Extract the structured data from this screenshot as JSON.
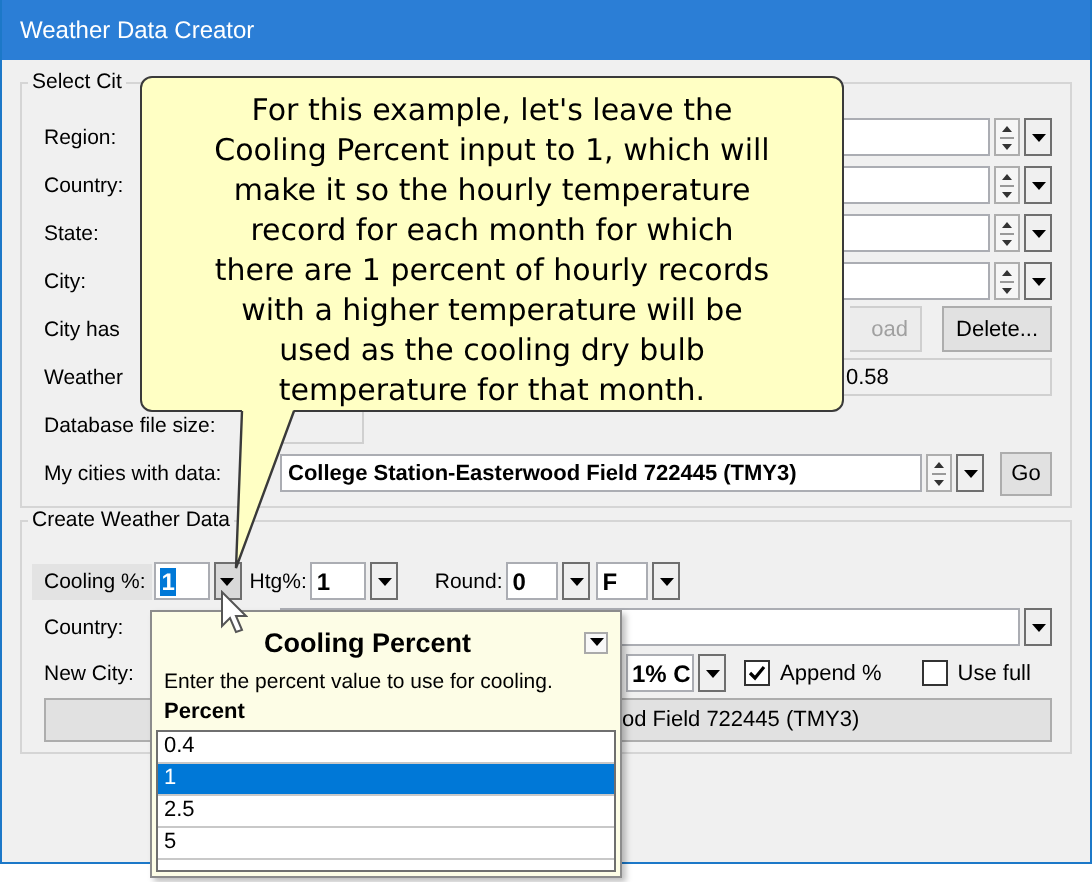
{
  "window": {
    "title": "Weather Data Creator"
  },
  "select_city": {
    "legend": "Select Cit",
    "rows": [
      {
        "kind": "combo",
        "label": "Region:"
      },
      {
        "kind": "combo",
        "label": "Country:"
      },
      {
        "kind": "combo",
        "label": "State:"
      },
      {
        "kind": "combo",
        "label": "City:"
      },
      {
        "kind": "buttons",
        "label": "City has",
        "buttons": [
          {
            "label": "oad",
            "disabled": true
          },
          {
            "label": "Delete...",
            "disabled": false
          }
        ]
      },
      {
        "kind": "readout",
        "label": "Weather",
        "value": "0.58"
      },
      {
        "kind": "readout",
        "label": "Database file size:"
      },
      {
        "kind": "combo",
        "label": "My cities with data:",
        "value": "College Station-Easterwood Field 722445 (TMY3)",
        "button": "Go"
      }
    ]
  },
  "create": {
    "legend": "Create Weather Data",
    "cooling": {
      "label": "Cooling %:",
      "value": "1"
    },
    "htg": {
      "label": "Htg%:",
      "value": "1"
    },
    "round": {
      "label": "Round:",
      "value": "0"
    },
    "units": {
      "value": "F"
    },
    "country": {
      "label": "Country:"
    },
    "new_city": {
      "label": "New City:"
    },
    "design": {
      "value": "1% C"
    },
    "checks": [
      {
        "label": "Append %",
        "checked": true
      },
      {
        "label": "Use full",
        "checked": false
      }
    ],
    "create_button": "od Field 722445 (TMY3)"
  },
  "popup": {
    "title": "Cooling Percent",
    "description": "Enter the percent value to use for cooling.",
    "column": "Percent",
    "options": [
      {
        "label": "0.4",
        "selected": false
      },
      {
        "label": "1",
        "selected": true
      },
      {
        "label": "2.5",
        "selected": false
      },
      {
        "label": "5",
        "selected": false
      }
    ]
  },
  "callout": {
    "lines": [
      "For this example, let's leave the",
      "Cooling Percent input to 1, which will",
      "make it so the hourly temperature",
      "record for each month for which",
      "there are 1 percent of hourly records",
      "with a higher temperature will be",
      "used as the cooling dry bulb",
      "temperature for that month."
    ]
  }
}
